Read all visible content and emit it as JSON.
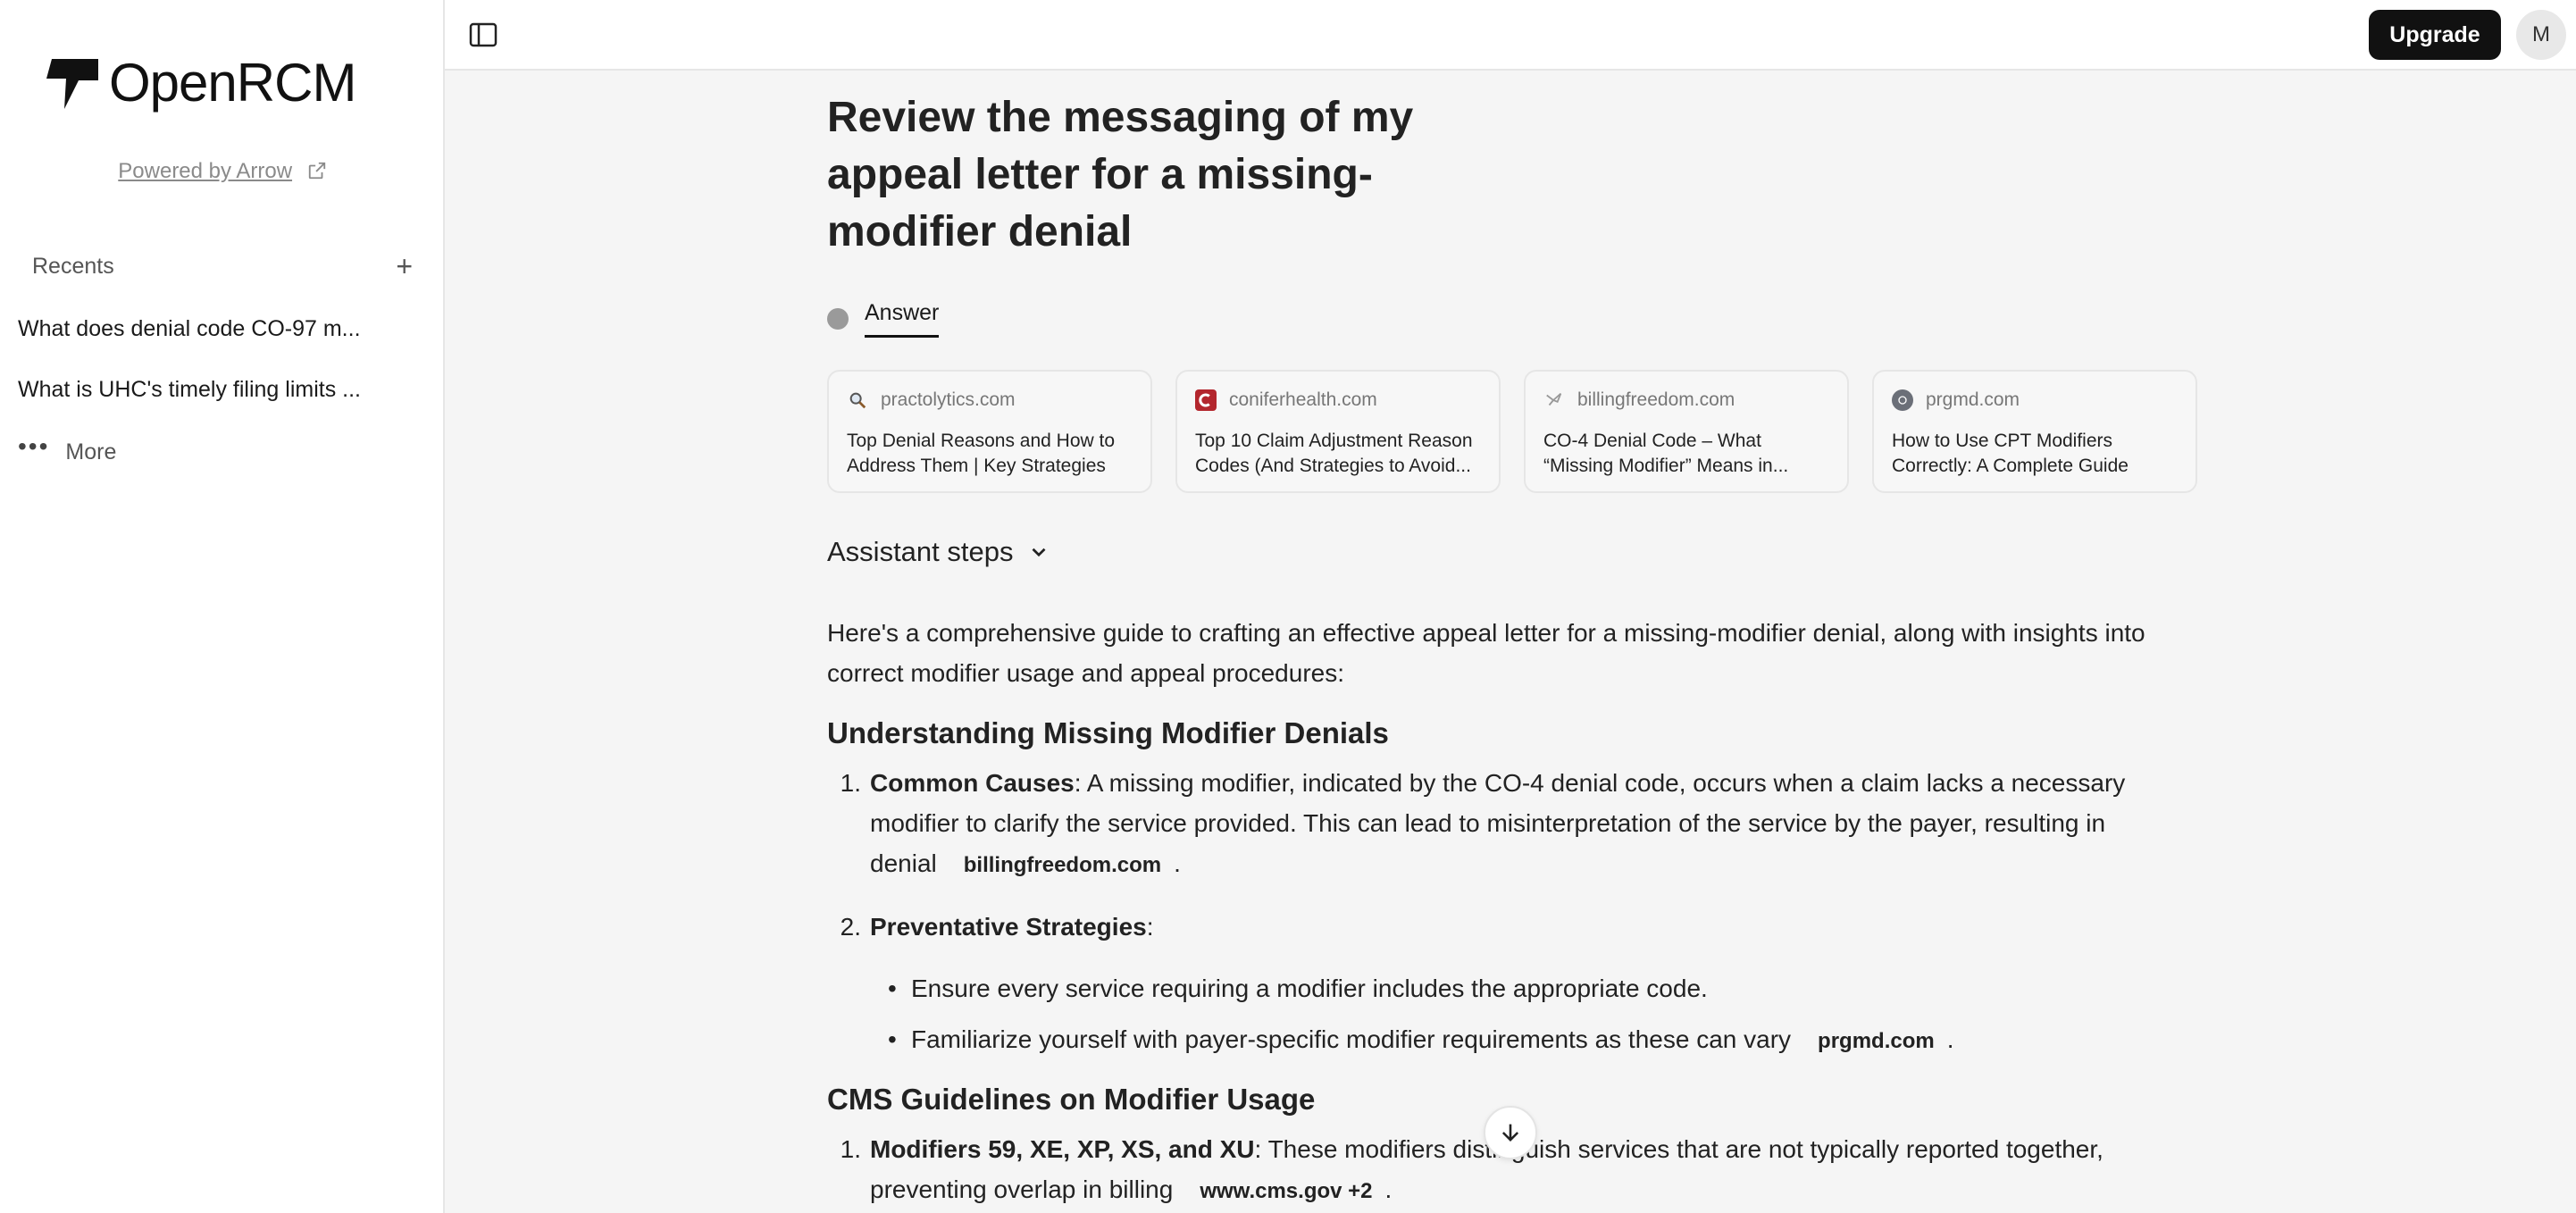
{
  "sidebar": {
    "logo_text": "OpenRCM",
    "powered_by": "Powered by Arrow",
    "recents_label": "Recents",
    "recents": [
      {
        "label": "What does denial code CO-97 m..."
      },
      {
        "label": "What is UHC's timely filing limits ..."
      }
    ],
    "more_label": "More"
  },
  "topbar": {
    "upgrade_label": "Upgrade",
    "avatar_initial": "M"
  },
  "thread": {
    "question": "Review the messaging of my appeal letter for a missing-modifier denial",
    "answer_tab": "Answer",
    "sources": [
      {
        "domain": "practolytics.com",
        "title": "Top Denial Reasons and How to Address Them | Key Strategies",
        "icon": "magnifier-icon"
      },
      {
        "domain": "coniferhealth.com",
        "title": "Top 10 Claim Adjustment Reason Codes (And Strategies to Avoid...",
        "icon": "conifer-c-icon"
      },
      {
        "domain": "billingfreedom.com",
        "title": "CO-4 Denial Code – What “Missing Modifier” Means in...",
        "icon": "bird-icon"
      },
      {
        "domain": "prgmd.com",
        "title": "How to Use CPT Modifiers Correctly: A Complete Guide",
        "icon": "prgmd-icon"
      }
    ],
    "assistant_steps_label": "Assistant steps",
    "intro": "Here's a comprehensive guide to crafting an effective appeal letter for a missing-modifier denial, along with insights into correct modifier usage and appeal procedures:",
    "section1": {
      "heading": "Understanding Missing Modifier Denials",
      "item1": {
        "num": "1.",
        "bold": "Common Causes",
        "text": ": A missing modifier, indicated by the CO-4 denial code, occurs when a claim lacks a necessary modifier to clarify the service provided. This can lead to misinterpretation of the service by the payer, resulting in denial",
        "cite": "billingfreedom.com",
        "end": "."
      },
      "item2": {
        "num": "2.",
        "bold": "Preventative Strategies",
        "text": ":",
        "bullets": [
          {
            "text": "Ensure every service requiring a modifier includes the appropriate code.",
            "cite": "",
            "end": ""
          },
          {
            "text": "Familiarize yourself with payer-specific modifier requirements as these can vary",
            "cite": "prgmd.com",
            "end": "."
          }
        ]
      }
    },
    "section2": {
      "heading": "CMS Guidelines on Modifier Usage",
      "item1": {
        "num": "1.",
        "bold": "Modifiers 59, XE, XP, XS, and XU",
        "text": ": These modifiers distinguish services that are not typically reported together, preventing overlap in billing",
        "cite": "www.cms.gov +2",
        "end": "."
      }
    }
  },
  "colors": {
    "accent": "#111111",
    "conifer_red": "#b3262d",
    "background": "#f5f5f5"
  }
}
